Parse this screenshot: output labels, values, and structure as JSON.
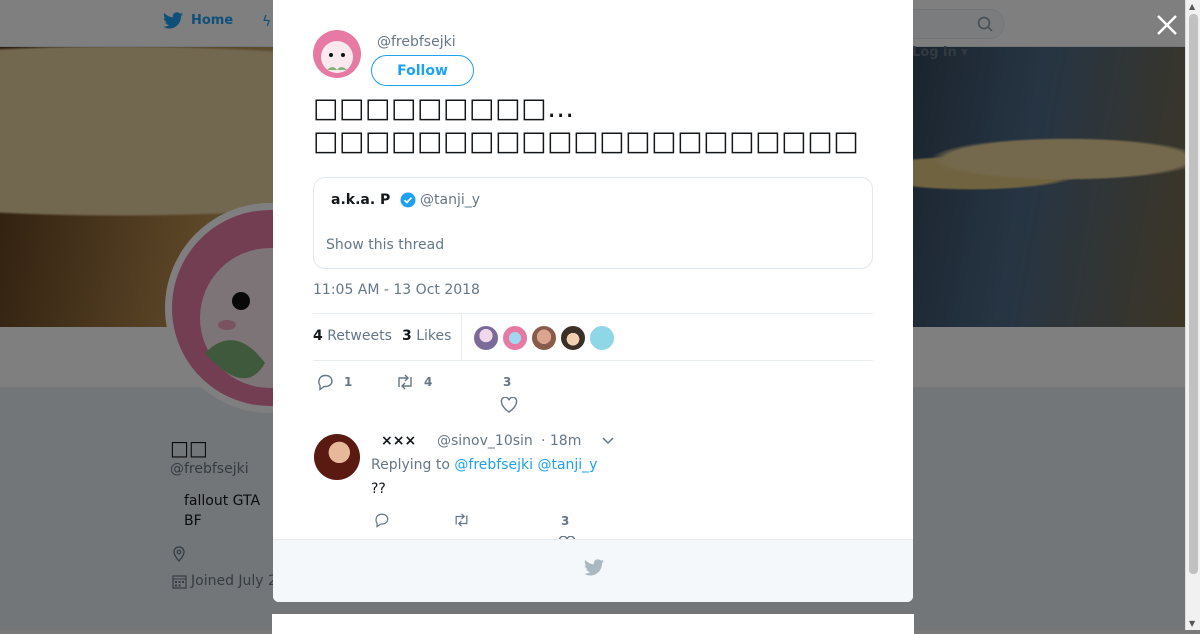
{
  "nav": {
    "home_label": "Home",
    "login_label": "Log in"
  },
  "profile": {
    "name": "□□",
    "handle": "@frebfsejki",
    "bio_line1": "fallout  GTA",
    "bio_line2": "BF",
    "joined": "Joined July 2"
  },
  "tweet": {
    "handle": "@frebfsejki",
    "follow_label": "Follow",
    "text": "□□□□□□□□□…\n□□□□□□□□□□□□□□□□□□□□□",
    "timestamp": "11:05 AM - 13 Oct 2018",
    "retweets_count": "4",
    "retweets_label": "Retweets",
    "likes_count": "3",
    "likes_label": "Likes",
    "reply_count": "1",
    "retweet_action_count": "4",
    "like_action_count": "3"
  },
  "quote": {
    "name": "a.k.a. P",
    "handle": "@tanji_y",
    "show_thread": "Show this thread"
  },
  "reply": {
    "name": "×××",
    "handle": "@sinov_10sin",
    "time": "· 18m",
    "replying_prefix": "Replying to",
    "mention1": "@frebfsejki",
    "mention2": "@tanji_y",
    "text": "??",
    "like_count": "3"
  },
  "colors": {
    "accent": "#1da1f2",
    "muted": "#657786"
  }
}
